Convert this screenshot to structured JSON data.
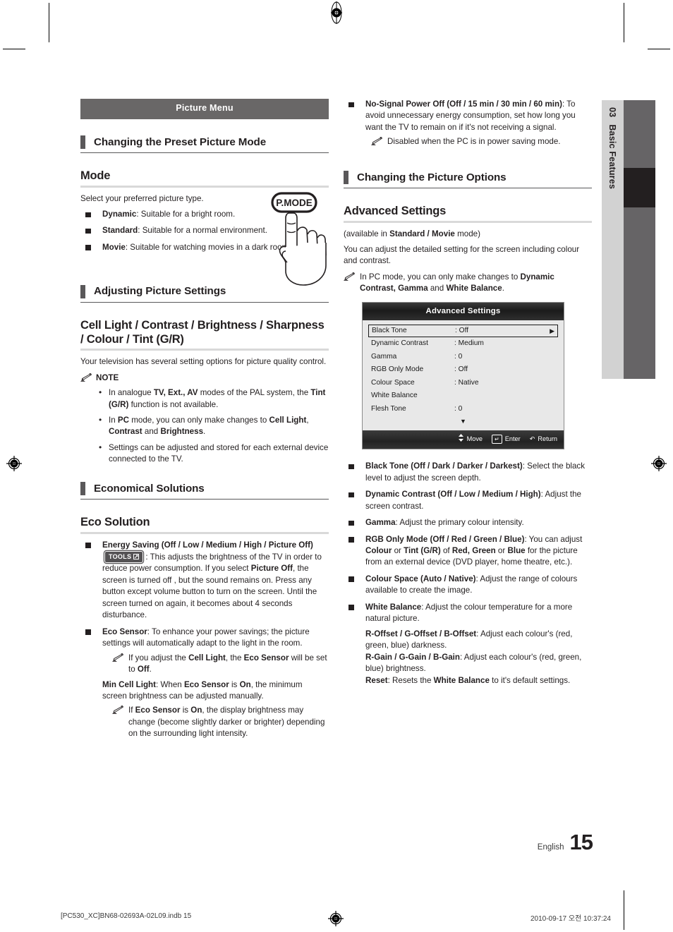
{
  "page": {
    "chapter_number": "03",
    "chapter_title": "Basic Features",
    "language": "English",
    "page_number": "15",
    "slug_left": "[PC530_XC]BN68-02693A-02L09.indb   15",
    "slug_right": "2010-09-17   오전 10:37:24",
    "accent_dark": "#231f20",
    "banner_gray": "#696767",
    "tab_gray": "#d2d2d2",
    "bar_gray": "#666466"
  },
  "left": {
    "banner": "Picture Menu",
    "section1": {
      "title": "Changing the Preset Picture Mode"
    },
    "mode": {
      "title": "Mode",
      "intro": "Select your preferred picture type.",
      "items": [
        {
          "term": "Dynamic",
          "text": ": Suitable for a bright room."
        },
        {
          "term": "Standard",
          "text": ": Suitable for a normal environment."
        },
        {
          "term": "Movie",
          "text": ": Suitable for watching movies in a dark room."
        }
      ],
      "remote_button_label": "P.MODE"
    },
    "section2": {
      "title": "Adjusting Picture Settings"
    },
    "cell_light": {
      "title": "Cell Light / Contrast / Brightness / Sharpness / Colour / Tint (G/R)",
      "intro": "Your television has several setting options for picture quality control.",
      "note_label": "NOTE",
      "notes": [
        "In analogue TV, Ext., AV modes of the PAL system, the Tint (G/R) function is not available.",
        "In PC mode, you can only make changes to Cell Light, Contrast and Brightness.",
        "Settings can be adjusted and stored for each external device connected to the TV."
      ]
    },
    "section3": {
      "title": "Economical Solutions"
    },
    "eco": {
      "title": "Eco Solution",
      "energy_saving_term": "Energy Saving (Off / Low / Medium / High / Picture Off)",
      "tools_chip": "TOOLS",
      "energy_saving_text": ": This adjusts the brightness of the TV in order to reduce power consumption. If you select Picture Off, the screen is turned off , but the sound remains on. Press any button except volume button to turn on the screen. Until the screen turned on again, it becomes about 4 seconds disturbance.",
      "eco_sensor_term": "Eco Sensor",
      "eco_sensor_text": ": To enhance your power savings; the picture settings will automatically adapt to the light in the room.",
      "eco_sensor_note": "If you adjust the Cell Light, the Eco Sensor will be set to Off.",
      "min_cell_light_term": "Min Cell Light",
      "min_cell_light_text": ": When Eco Sensor is On, the minimum screen brightness can be adjusted manually.",
      "min_cell_light_note": "If Eco Sensor is On, the display brightness may change (become slightly darker or brighter) depending on the surrounding light intensity."
    }
  },
  "right": {
    "no_signal": {
      "term": "No-Signal Power Off (Off / 15 min / 30 min / 60 min)",
      "text": ": To avoid unnecessary energy consumption, set how long you want the TV to remain on if it's not receiving a signal.",
      "note": "Disabled when the PC is in power saving mode."
    },
    "section1": {
      "title": "Changing the Picture Options"
    },
    "advanced": {
      "title": "Advanced Settings",
      "availability": "(available in Standard / Movie mode)",
      "intro": "You can adjust the detailed setting for the screen including colour and contrast.",
      "note": "In PC mode, you can only make changes to Dynamic Contrast, Gamma and White Balance."
    },
    "osd": {
      "title": "Advanced Settings",
      "rows": [
        {
          "label": "Black Tone",
          "value": ": Off",
          "selected": true,
          "arrow": "▶"
        },
        {
          "label": "Dynamic Contrast",
          "value": ": Medium",
          "selected": false,
          "arrow": ""
        },
        {
          "label": "Gamma",
          "value": ": 0",
          "selected": false,
          "arrow": ""
        },
        {
          "label": "RGB Only Mode",
          "value": ": Off",
          "selected": false,
          "arrow": ""
        },
        {
          "label": "Colour Space",
          "value": ": Native",
          "selected": false,
          "arrow": ""
        },
        {
          "label": "White Balance",
          "value": "",
          "selected": false,
          "arrow": ""
        },
        {
          "label": "Flesh Tone",
          "value": ": 0",
          "selected": false,
          "arrow": ""
        }
      ],
      "scroll_glyph": "▼",
      "footer": [
        {
          "icon": "⬍",
          "label": "Move"
        },
        {
          "icon": "↲",
          "label": "Enter"
        },
        {
          "icon": "↺",
          "label": "Return"
        }
      ]
    },
    "options": [
      {
        "term": "Black Tone (Off / Dark / Darker / Darkest)",
        "text": ": Select the black level to adjust the screen depth."
      },
      {
        "term": "Dynamic Contrast (Off / Low / Medium / High)",
        "text": ": Adjust the screen contrast."
      },
      {
        "term": "Gamma",
        "text": ": Adjust the primary colour intensity."
      },
      {
        "term": "RGB Only Mode (Off / Red / Green / Blue)",
        "text": ": You can adjust Colour or Tint (G/R) of Red, Green or Blue for the picture from an external device (DVD player, home theatre, etc.)."
      },
      {
        "term": "Colour Space (Auto / Native)",
        "text": ": Adjust the range of colours available to create the image."
      },
      {
        "term": "White Balance",
        "text": ": Adjust the colour temperature for a more natural picture."
      }
    ],
    "white_balance_details": [
      {
        "term": "R-Offset / G-Offset / B-Offset",
        "text": ": Adjust each colour's (red, green, blue) darkness."
      },
      {
        "term": "R-Gain / G-Gain / B-Gain",
        "text": ": Adjust each colour's (red, green, blue) brightness."
      },
      {
        "term": "Reset",
        "text": ": Resets the White Balance to it's default settings."
      }
    ]
  }
}
